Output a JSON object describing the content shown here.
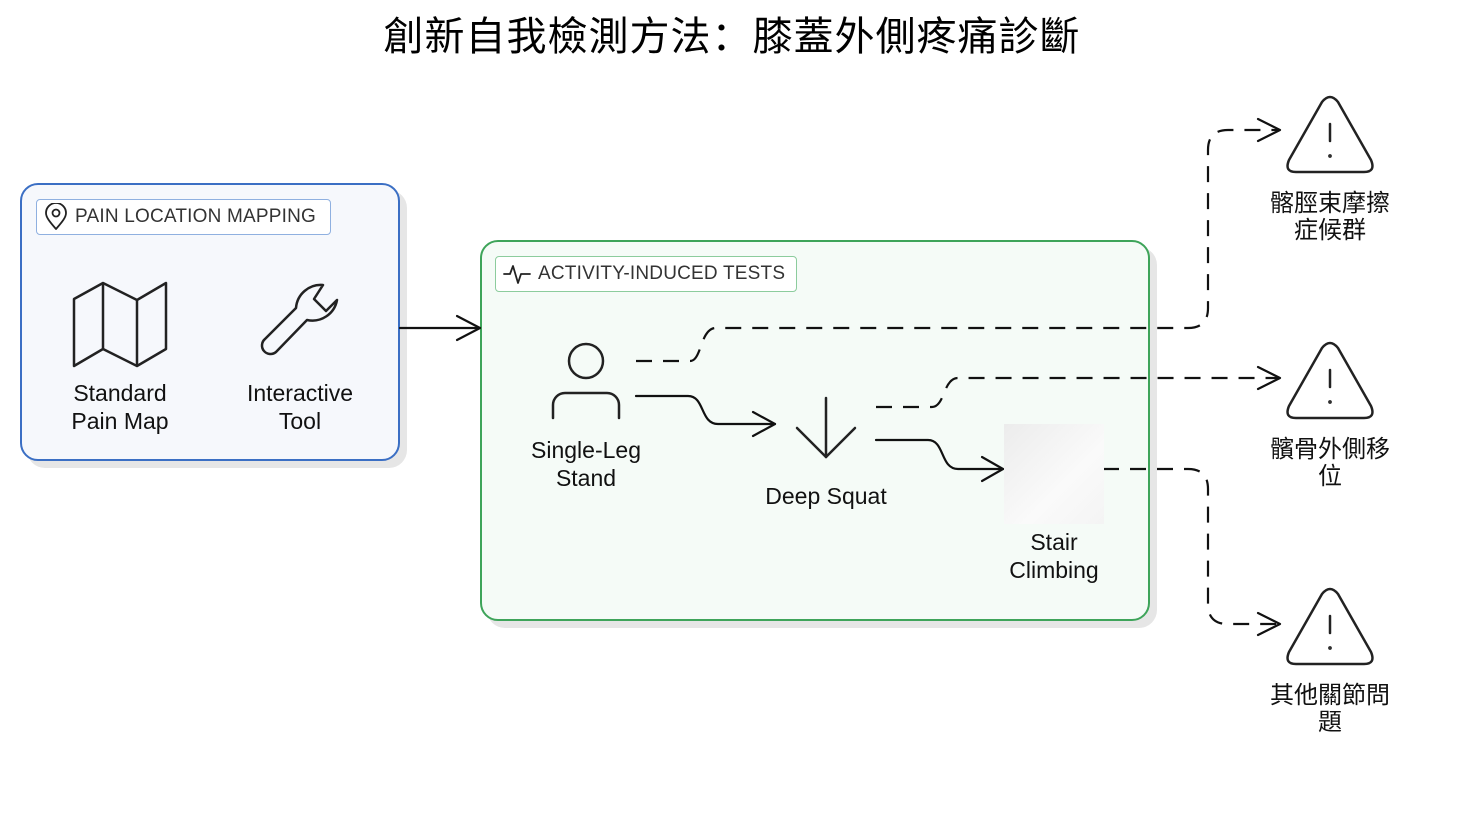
{
  "title": "創新自我檢測方法：膝蓋外側疼痛診斷",
  "groups": {
    "pain_mapping": {
      "label": "PAIN LOCATION MAPPING",
      "icon": "map-pin-icon",
      "border_color": "#3b6fc4",
      "nodes": [
        {
          "id": "standard-pain-map",
          "label_lines": [
            "Standard",
            "Pain Map"
          ],
          "icon": "map-icon"
        },
        {
          "id": "interactive-tool",
          "label_lines": [
            "Interactive",
            "Tool"
          ],
          "icon": "wrench-icon"
        }
      ]
    },
    "activity_tests": {
      "label": "ACTIVITY-INDUCED TESTS",
      "icon": "activity-pulse-icon",
      "border_color": "#3ea45a",
      "nodes": [
        {
          "id": "single-leg-stand",
          "label_lines": [
            "Single-Leg",
            "Stand"
          ],
          "icon": "user-icon"
        },
        {
          "id": "deep-squat",
          "label_lines": [
            "Deep Squat"
          ],
          "icon": "arrow-down-icon"
        },
        {
          "id": "stair-climbing",
          "label_lines": [
            "Stair",
            "Climbing"
          ],
          "icon": "image-placeholder"
        }
      ]
    }
  },
  "outcomes": [
    {
      "id": "itbs",
      "label_lines": [
        "髂脛束摩擦",
        "症候群"
      ],
      "icon": "warning-triangle-icon"
    },
    {
      "id": "patella-lateral",
      "label_lines": [
        "髕骨外側移",
        "位"
      ],
      "icon": "warning-triangle-icon"
    },
    {
      "id": "other-joint",
      "label_lines": [
        "其他關節問",
        "題"
      ],
      "icon": "warning-triangle-icon"
    }
  ],
  "edges": [
    {
      "from": "pain_mapping",
      "to": "activity_tests",
      "style": "solid"
    },
    {
      "from": "single-leg-stand",
      "to": "deep-squat",
      "style": "solid"
    },
    {
      "from": "deep-squat",
      "to": "stair-climbing",
      "style": "solid"
    },
    {
      "from": "single-leg-stand",
      "to": "itbs",
      "style": "dashed"
    },
    {
      "from": "deep-squat",
      "to": "patella-lateral",
      "style": "dashed"
    },
    {
      "from": "stair-climbing",
      "to": "other-joint",
      "style": "dashed"
    }
  ]
}
